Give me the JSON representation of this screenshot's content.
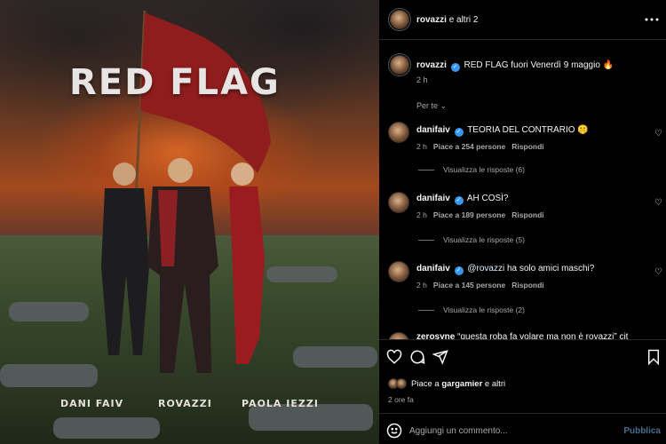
{
  "cover": {
    "title": "RED FLAG",
    "artists": [
      "DANI FAIV",
      "ROVAZZI",
      "PAOLA IEZZI"
    ]
  },
  "header": {
    "user": "rovazzi",
    "suffix": "e altri 2",
    "more_icon": "ellipsis-icon"
  },
  "caption": {
    "user": "rovazzi",
    "text": "RED FLAG fuori Venerdì 9 maggio",
    "emoji": "🔥",
    "time": "2 h"
  },
  "sort_label": "Per te",
  "comments": [
    {
      "user": "danifaiv",
      "text": "TEORIA DEL CONTRARIO",
      "emoji": "🤫",
      "time": "2 h",
      "likes": "Piace a 254 persone",
      "reply": "Rispondi",
      "view_replies": "Visualizza le risposte (6)"
    },
    {
      "user": "danifaiv",
      "text": "AH COSÌ?",
      "emoji": "",
      "time": "2 h",
      "likes": "Piace a 189 persone",
      "reply": "Rispondi",
      "view_replies": "Visualizza le risposte (5)"
    },
    {
      "user": "danifaiv",
      "mention": "@rovazzi",
      "text": "ha solo amici maschi?",
      "emoji": "",
      "time": "2 h",
      "likes": "Piace a 145 persone",
      "reply": "Rispondi",
      "view_replies": "Visualizza le risposte (2)"
    }
  ],
  "partial_comment": {
    "user": "zerosyne",
    "text": "“questa roba fa volare ma non è rovazzi” cit"
  },
  "likes_line": {
    "prefix": "Piace a",
    "user": "gargamier",
    "suffix": "e altri"
  },
  "post_time": "2 ore fa",
  "comment_input": {
    "placeholder": "Aggiungi un commento...",
    "publish": "Pubblica",
    "emoji_icon": "smiley-icon"
  },
  "colors": {
    "background": "#000000",
    "verified": "#3897f0",
    "publish": "#4a6e8f",
    "muted": "#a8a8a8"
  }
}
